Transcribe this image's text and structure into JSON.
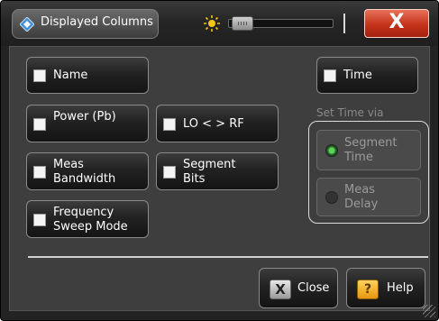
{
  "window": {
    "title": "Displayed Columns",
    "close_glyph": "X",
    "brightness_level": 0.05
  },
  "icons": {
    "app": "diamond-app-icon",
    "sun": "sun-icon",
    "close": "close-icon",
    "help": "help-icon"
  },
  "columns": {
    "name": "Name",
    "power": "Power (Pb)",
    "meas_bandwidth": "Meas Bandwidth",
    "freq_sweep_mode": "Frequency Sweep Mode",
    "lo_rf": "LO < > RF",
    "segment_bits": "Segment Bits",
    "time": "Time"
  },
  "set_time": {
    "label": "Set Time via",
    "segment_time": "Segment Time",
    "meas_delay": "Meas Delay",
    "selected": "segment_time"
  },
  "buttons": {
    "close": "Close",
    "help": "Help",
    "close_glyph": "X",
    "help_glyph": "?"
  },
  "colors": {
    "accent_close": "#c4331b",
    "help_icon": "#f2a81d",
    "radio_on": "#5ad35a"
  }
}
